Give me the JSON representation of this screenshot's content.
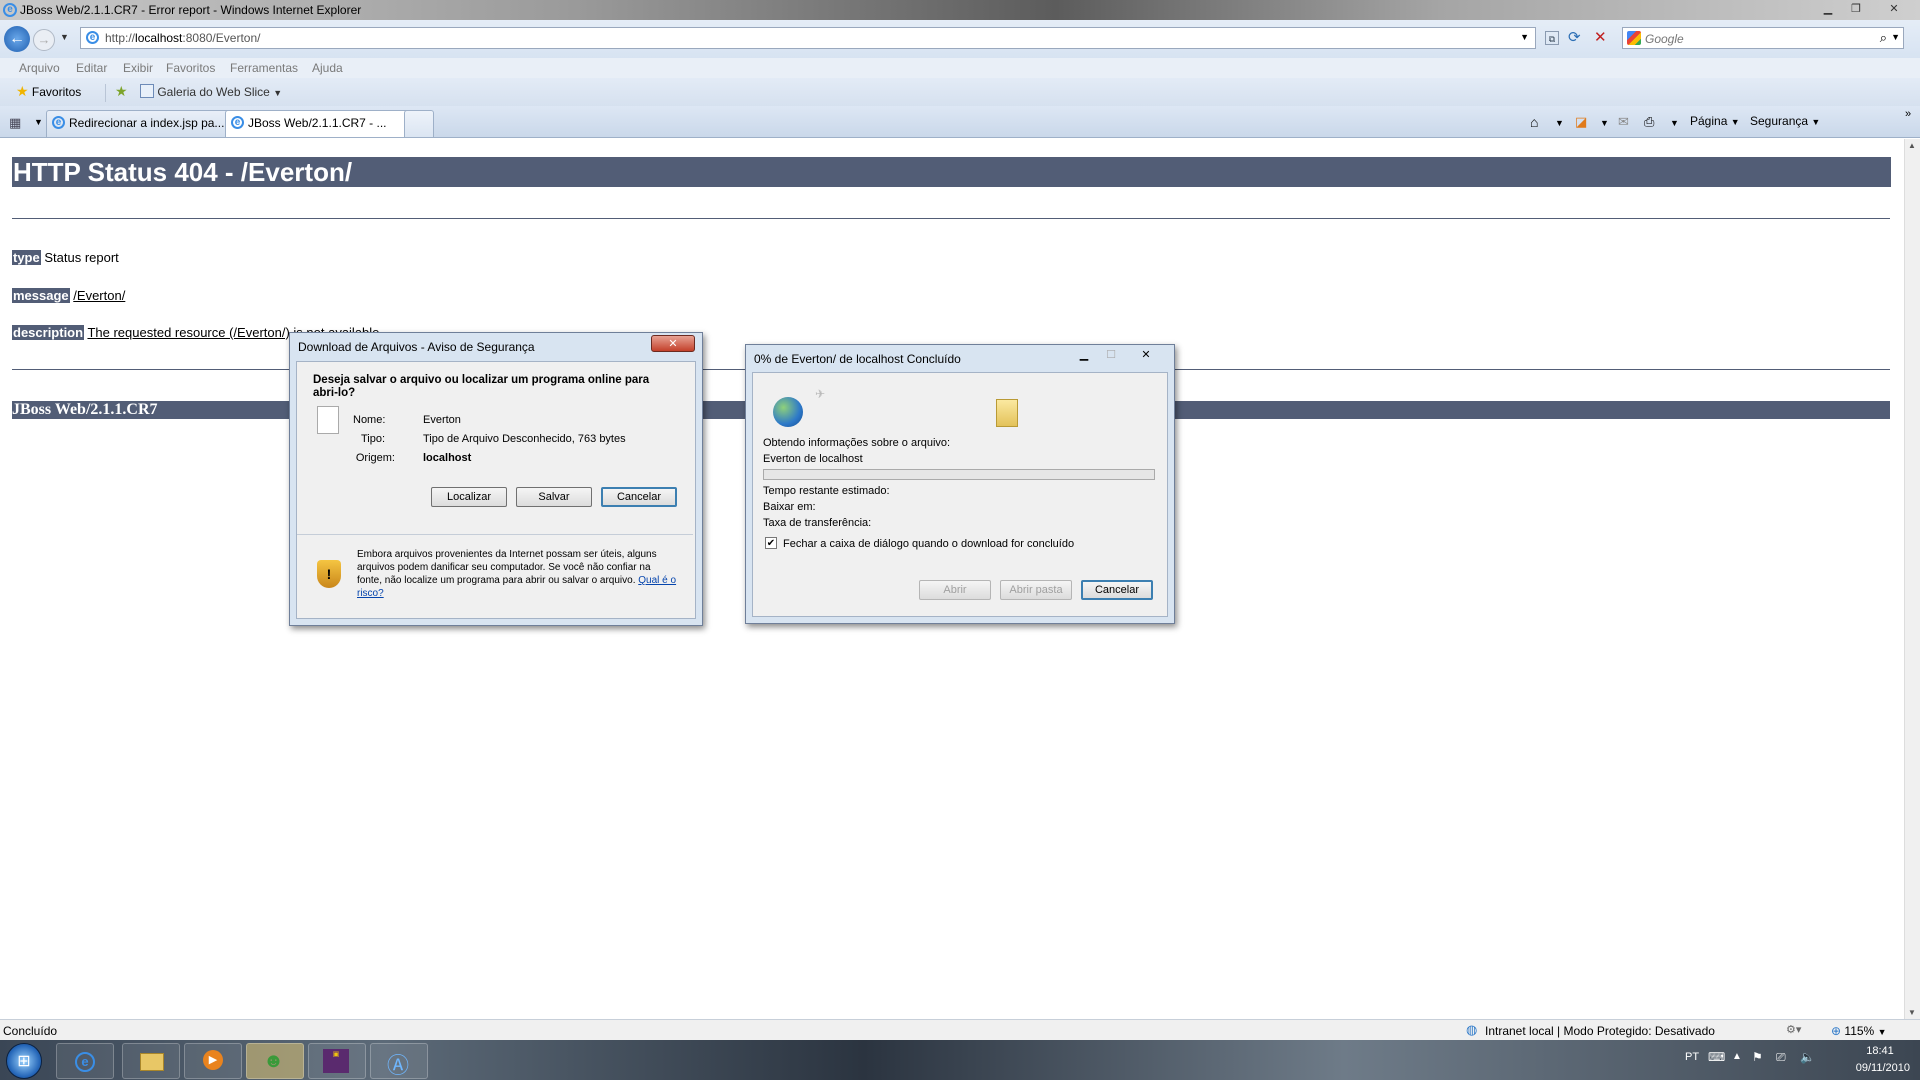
{
  "window": {
    "title": "JBoss Web/2.1.1.CR7 - Error report - Windows Internet Explorer"
  },
  "address": {
    "prefix": "http://",
    "host": "localhost",
    "rest": ":8080/Everton/"
  },
  "search": {
    "placeholder": "Google"
  },
  "menu": [
    "Arquivo",
    "Editar",
    "Exibir",
    "Favoritos",
    "Ferramentas",
    "Ajuda"
  ],
  "favbar": {
    "favorites": "Favoritos",
    "webslice": "Galeria do Web Slice"
  },
  "tabs": [
    {
      "label": "Redirecionar a index.jsp pa..."
    },
    {
      "label": "JBoss Web/2.1.1.CR7 - ..."
    }
  ],
  "commands": {
    "page": "Página",
    "security": "Segurança"
  },
  "page": {
    "heading": "HTTP Status 404 - /Everton/",
    "type_label": "type",
    "type_value": "Status report",
    "message_label": "message",
    "message_value": "/Everton/",
    "description_label": "description",
    "description_value": "The requested resource (/Everton/) is not available.",
    "footer": "JBoss Web/2.1.1.CR7"
  },
  "security_dialog": {
    "title": "Download de Arquivos - Aviso de Segurança",
    "question": "Deseja salvar o arquivo ou localizar um programa online para abri-lo?",
    "name_label": "Nome:",
    "name_value": "Everton",
    "type_label": "Tipo:",
    "type_value": "Tipo de Arquivo Desconhecido, 763 bytes",
    "origin_label": "Origem:",
    "origin_value": "localhost",
    "btn_find": "Localizar",
    "btn_save": "Salvar",
    "btn_cancel": "Cancelar",
    "warning": "Embora arquivos provenientes da Internet possam ser úteis, alguns arquivos podem danificar seu computador. Se você não confiar na fonte, não localize um programa para abrir ou salvar o arquivo.",
    "risk_link": "Qual é o risco?"
  },
  "progress_dialog": {
    "title": "0% de Everton/ de localhost Concluído",
    "getting_info": "Obtendo informações sobre o arquivo:",
    "source": "Everton de localhost",
    "progress": 0,
    "time_left": "Tempo restante estimado:",
    "download_to": "Baixar em:",
    "transfer_rate": "Taxa de transferência:",
    "close_checkbox": "Fechar a caixa de diálogo quando o download for concluído",
    "close_checked": true,
    "btn_open": "Abrir",
    "btn_open_folder": "Abrir pasta",
    "btn_cancel": "Cancelar"
  },
  "status": {
    "text": "Concluído",
    "zone": "Intranet local | Modo Protegido: Desativado",
    "zoom": "115%"
  },
  "taskbar": {
    "lang": "PT",
    "time": "18:41",
    "date": "09/11/2010"
  }
}
